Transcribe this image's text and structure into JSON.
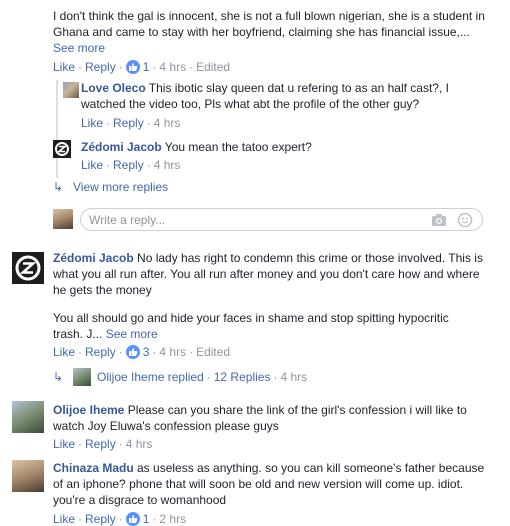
{
  "c1": {
    "text": "I don't think the gal is innocent, she is not a full blown nigerian, she is a student in Ghana and came to stay with her boyfriend, claiming she has financial issue,... ",
    "see_more": "See more",
    "like": "Like",
    "reply": "Reply",
    "reactions": "1",
    "time": "4 hrs",
    "edited": "Edited"
  },
  "r1": {
    "author": "Love Oleco",
    "text": " This ibotic slay queen dat u refering to as an half cast?, I watched the video too, Pls what abt the profile of the other guy?",
    "like": "Like",
    "reply": "Reply",
    "time": "4 hrs"
  },
  "r2": {
    "author": "Zédomi Jacob",
    "text": " You mean the tatoo expert?",
    "like": "Like",
    "reply": "Reply",
    "time": "4 hrs"
  },
  "view_more": "View more replies",
  "reply_box": {
    "placeholder": "Write a reply..."
  },
  "c2": {
    "author": "Zédomi Jacob",
    "text": " No lady has right to condemn this crime or those involved. This is what you all run after. You all run after money and you don't care how and where he gets the money",
    "text2": "You all should go and hide your faces in shame and stop spitting hypocritic trash. J... ",
    "see_more": "See more",
    "like": "Like",
    "reply": "Reply",
    "reactions": "3",
    "time": "4 hrs",
    "edited": "Edited",
    "replied_author": "Olijoe Iheme",
    "replied_label": "replied",
    "replies_count": "12 Replies",
    "replies_time": "4 hrs"
  },
  "c3": {
    "author": "Olijoe Iheme",
    "text": " Please can you share the link of the girl's confession i will like to watch Joy Eluwa's confession please guys",
    "like": "Like",
    "reply": "Reply",
    "time": "4 hrs"
  },
  "c4": {
    "author": "Chinaza Madu",
    "text": " as useless as anything. so you can kill someone's father because of an iphone? phone that will soon be old and new version will come up. idiot. you're a disgrace to womanhood",
    "like": "Like",
    "reply": "Reply",
    "reactions": "1",
    "time": "2 hrs"
  },
  "colors": {
    "link": "#4267b2",
    "author": "#365899",
    "meta": "#90949c",
    "like_badge": "#5890ff"
  }
}
